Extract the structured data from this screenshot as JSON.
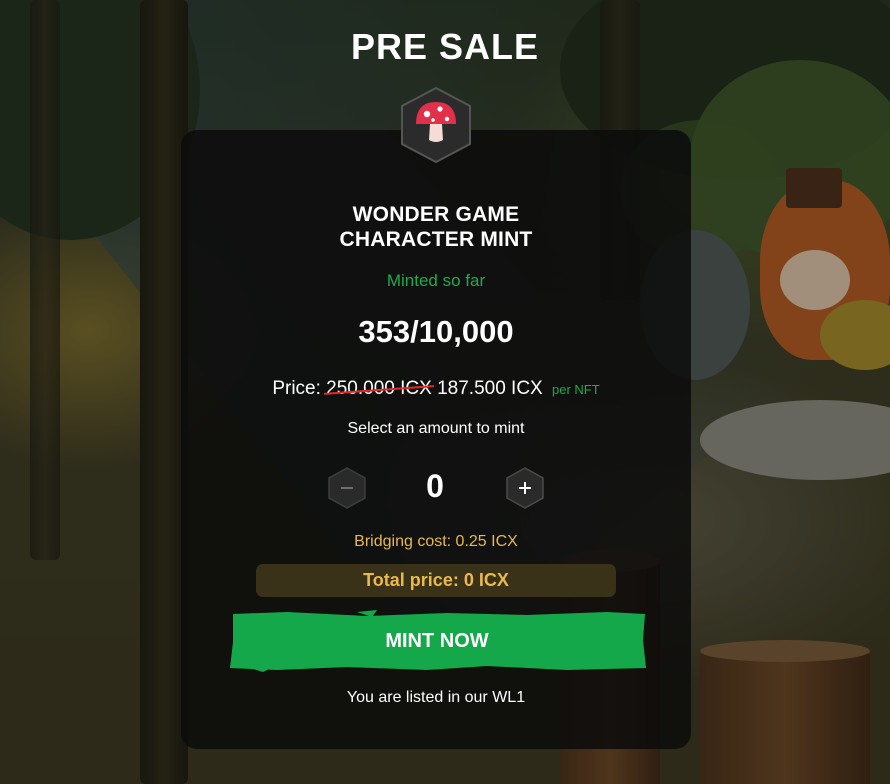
{
  "page": {
    "title": "PRE SALE"
  },
  "card": {
    "title_line1": "WONDER GAME",
    "title_line2": "CHARACTER MINT",
    "minted_label": "Minted so far",
    "minted_count": "353/10,000",
    "price_label": "Price:",
    "old_price": "250.000 ICX",
    "new_price": "187.500 ICX",
    "per_nft": "per NFT",
    "select_label": "Select an amount to mint",
    "quantity": "0",
    "minus_symbol": "−",
    "plus_symbol": "+",
    "bridging_cost": "Bridging cost: 0.25 ICX",
    "total_price": "Total price: 0 ICX",
    "mint_button": "MINT NOW",
    "wl_note": "You are listed in our WL1"
  },
  "badge": {
    "icon": "mushroom-icon"
  },
  "colors": {
    "accent_green": "#1faa4f",
    "button_green": "#14a84a",
    "gold": "#e9b949",
    "strike_red": "#e12a2a",
    "mushroom_red": "#e0304a",
    "card_bg": "#0c0c0c"
  }
}
